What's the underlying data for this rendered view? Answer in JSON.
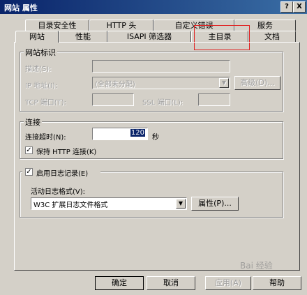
{
  "window": {
    "title": "网站 属性",
    "help_btn": "?",
    "close_btn": "X"
  },
  "tabs_back": [
    "目录安全性",
    "HTTP 头",
    "自定义错误",
    "服务"
  ],
  "tabs_front": [
    "网站",
    "性能",
    "ISAPI 筛选器",
    "主目录",
    "文档"
  ],
  "site_id": {
    "legend": "网站标识",
    "desc_label": "描述(S):",
    "ip_label": "IP 地址(I):",
    "ip_value": "(全部未分配)",
    "advanced_button": "高级(D)...",
    "tcp_label": "TCP 端口(T):",
    "ssl_label": "SSL 端口(L):"
  },
  "connection": {
    "legend": "连接",
    "timeout_label": "连接超时(N):",
    "timeout_value": "120",
    "timeout_unit": "秒",
    "keepalive_label": "保持 HTTP 连接(K)",
    "keepalive_checked": true
  },
  "logging": {
    "enable_label": "启用日志记录(E)",
    "enabled": true,
    "format_label": "活动日志格式(V):",
    "format_value": "W3C 扩展日志文件格式",
    "properties_button": "属性(P)..."
  },
  "buttons": {
    "ok": "确定",
    "cancel": "取消",
    "apply": "应用(A)",
    "help": "帮助"
  },
  "watermark": "Bai 经验",
  "colors": {
    "titlebar": "#0a246a",
    "face": "#d4d0c8",
    "highlight": "#e02020"
  }
}
